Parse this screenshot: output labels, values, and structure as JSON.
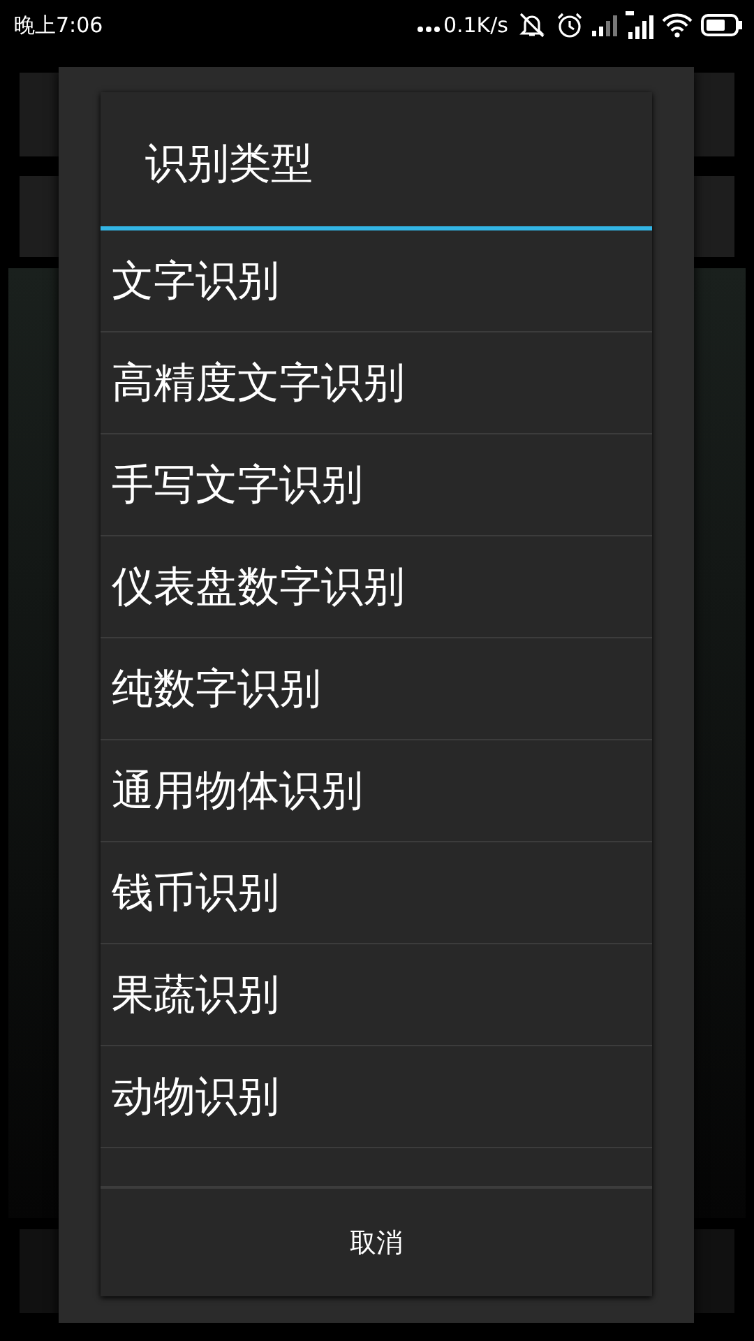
{
  "status_bar": {
    "time": "晚上7:06",
    "speed": "0.1K/s"
  },
  "dialog": {
    "title": "识别类型",
    "items": [
      "文字识别",
      "高精度文字识别",
      "手写文字识别",
      "仪表盘数字识别",
      "纯数字识别",
      "通用物体识别",
      "钱币识别",
      "果蔬识别",
      "动物识别"
    ],
    "cancel": "取消"
  }
}
